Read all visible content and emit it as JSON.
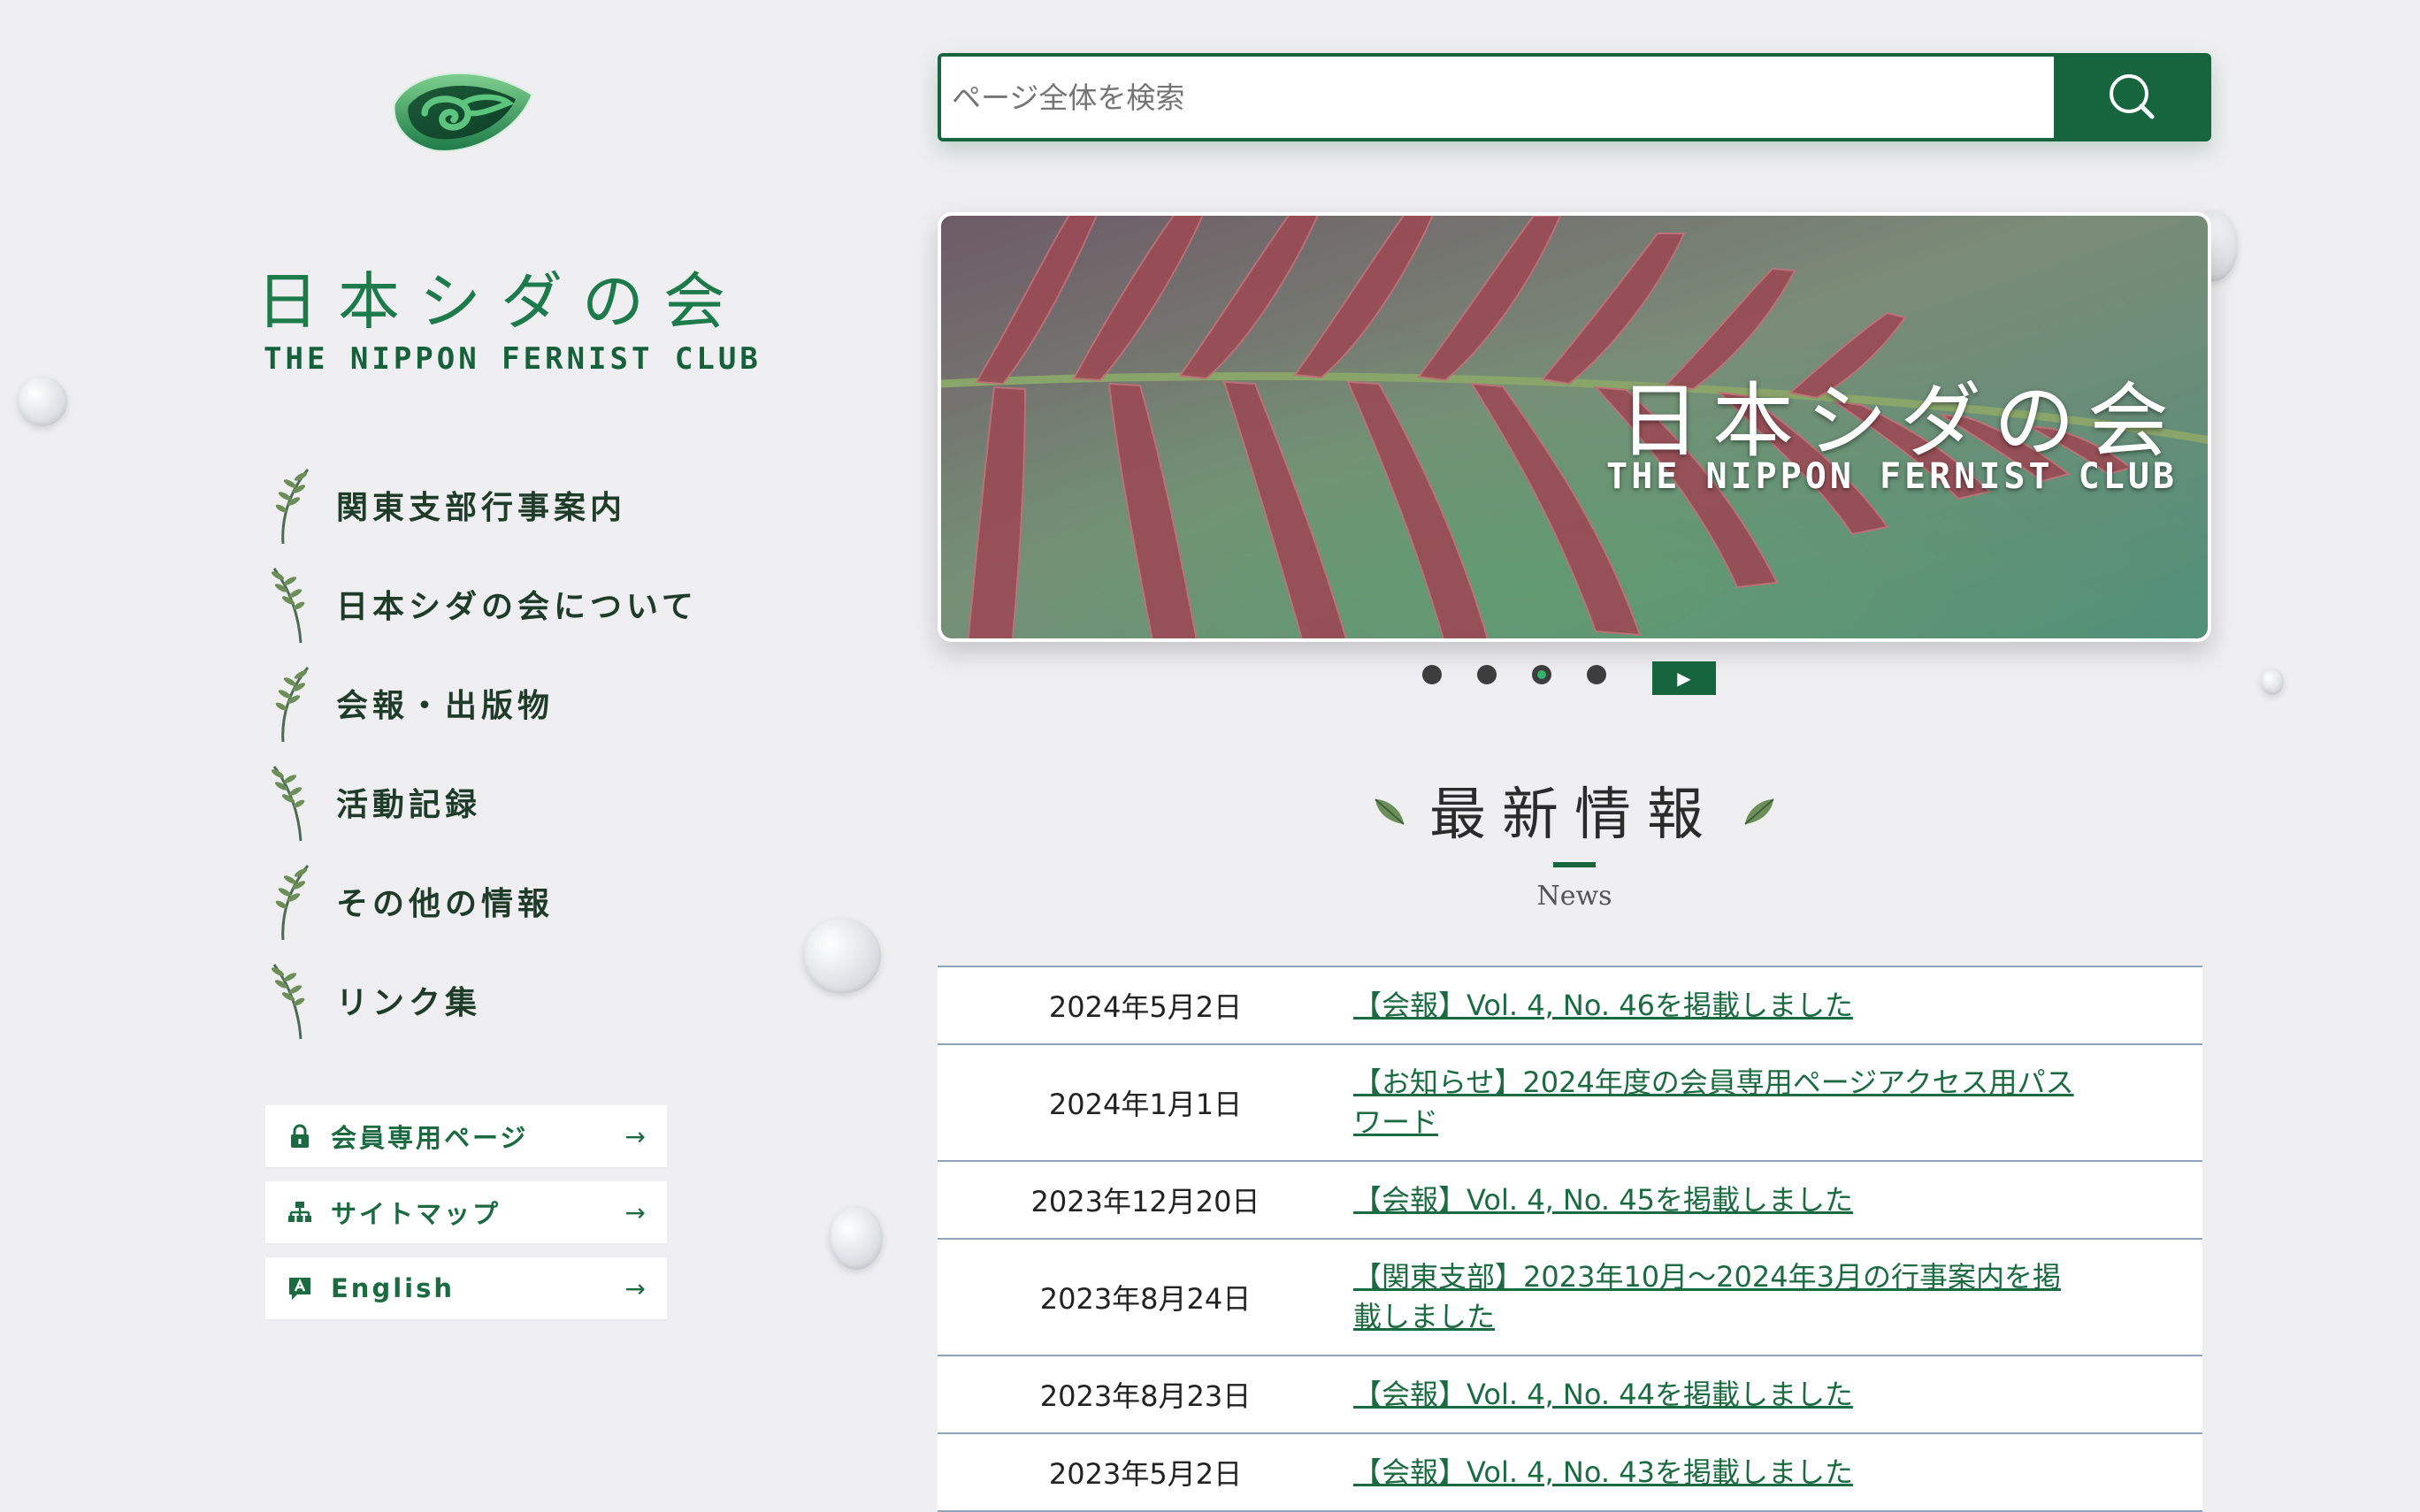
{
  "brand": {
    "name_jp": "日本シダの会",
    "name_en": "THE NIPPON FERNIST CLUB"
  },
  "nav": {
    "items": [
      {
        "label": "関東支部行事案内"
      },
      {
        "label": "日本シダの会について"
      },
      {
        "label": "会報・出版物"
      },
      {
        "label": "活動記録"
      },
      {
        "label": "その他の情報"
      },
      {
        "label": "リンク集"
      }
    ]
  },
  "side_buttons": {
    "members": {
      "label": "会員専用ページ",
      "arrow": "→",
      "icon": "lock-icon"
    },
    "sitemap": {
      "label": "サイトマップ",
      "arrow": "→",
      "icon": "sitemap-icon"
    },
    "english": {
      "label": "English",
      "arrow": "→",
      "icon": "language-icon"
    }
  },
  "search": {
    "placeholder": "ページ全体を検索",
    "icon": "search-icon"
  },
  "hero": {
    "title_jp": "日本シダの会",
    "title_en": "THE NIPPON FERNIST CLUB",
    "slide_count": 4,
    "active_slide": 3,
    "play_icon": "▶"
  },
  "news": {
    "title": "最新情報",
    "subtitle": "News",
    "items": [
      {
        "date": "2024年5月2日",
        "title": "【会報】Vol. 4, No. 46を掲載しました"
      },
      {
        "date": "2024年1月1日",
        "title": "【お知らせ】2024年度の会員専用ページアクセス用パスワード"
      },
      {
        "date": "2023年12月20日",
        "title": "【会報】Vol. 4, No. 45を掲載しました"
      },
      {
        "date": "2023年8月24日",
        "title": "【関東支部】2023年10月～2024年3月の行事案内を掲載しました"
      },
      {
        "date": "2023年8月23日",
        "title": "【会報】Vol. 4, No. 44を掲載しました"
      },
      {
        "date": "2023年5月2日",
        "title": "【会報】Vol. 4, No. 43を掲載しました"
      }
    ]
  },
  "colors": {
    "brand_green": "#17653f",
    "link_green": "#1b6a41",
    "page_bg": "#efeff1"
  }
}
